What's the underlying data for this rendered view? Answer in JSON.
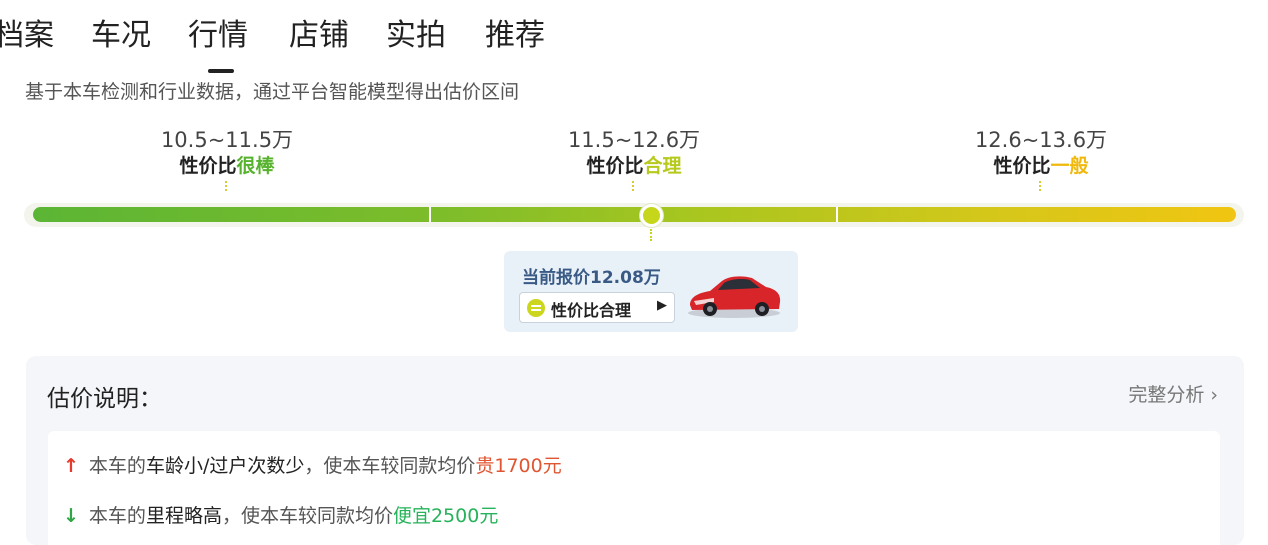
{
  "tabs": [
    {
      "label": "档案",
      "active": false
    },
    {
      "label": "车况",
      "active": false
    },
    {
      "label": "行情",
      "active": true
    },
    {
      "label": "店铺",
      "active": false
    },
    {
      "label": "实拍",
      "active": false
    },
    {
      "label": "推荐",
      "active": false
    }
  ],
  "subtitle": "基于本车检测和行业数据，通过平台智能模型得出估价区间",
  "segments": [
    {
      "range": "10.5~11.5万",
      "prefix": "性价比",
      "grade": "很棒",
      "color": "#57b32e"
    },
    {
      "range": "11.5~12.6万",
      "prefix": "性价比",
      "grade": "合理",
      "color": "#b6c91c"
    },
    {
      "range": "12.6~13.6万",
      "prefix": "性价比",
      "grade": "一般",
      "color": "#f0b90c"
    }
  ],
  "current": {
    "price_label": "当前报价12.08万",
    "price_value": 12.08,
    "badge": "性价比合理",
    "badge_arrow": "▶",
    "car_color": "#d8252a"
  },
  "explanation": {
    "title": "估价说明：",
    "link": "完整分析",
    "link_chevron": "›",
    "items": [
      {
        "direction": "up",
        "arrow": "↑",
        "pre": "本车的",
        "factor": "车龄小/过户次数少",
        "mid": "，使本车较同款均价",
        "effect": "贵1700元"
      },
      {
        "direction": "down",
        "arrow": "↓",
        "pre": "本车的",
        "factor": "里程略高",
        "mid": "，使本车较同款均价",
        "effect": "便宜2500元"
      }
    ]
  }
}
